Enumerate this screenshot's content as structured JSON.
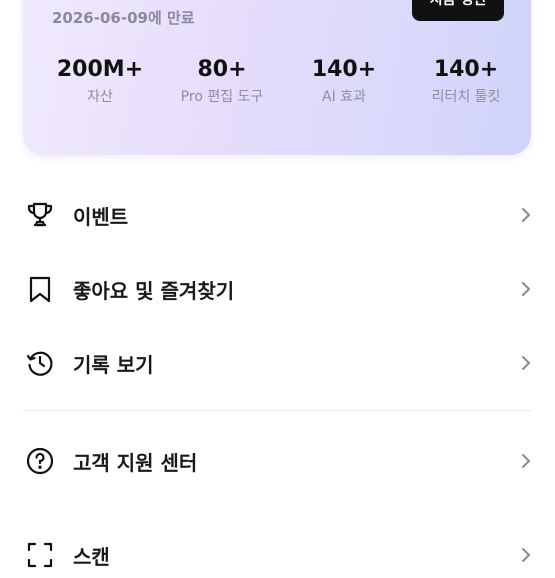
{
  "subscription": {
    "expiry": "2026-06-09에 만료",
    "renew_label": "지금 갱신"
  },
  "stats": [
    {
      "value": "200M+",
      "label": "자산"
    },
    {
      "value": "80+",
      "label": "Pro 편집 도구"
    },
    {
      "value": "140+",
      "label": "AI 효과"
    },
    {
      "value": "140+",
      "label": "리터치 툴킷"
    }
  ],
  "menu": {
    "items": [
      {
        "label": "이벤트",
        "icon": "trophy-icon"
      },
      {
        "label": "좋아요 및 즐겨찾기",
        "icon": "bookmark-icon"
      },
      {
        "label": "기록 보기",
        "icon": "history-icon"
      },
      {
        "label": "고객 지원 센터",
        "icon": "help-circle-icon"
      },
      {
        "label": "스캔",
        "icon": "scan-icon"
      }
    ]
  },
  "colors": {
    "card_gradient_start": "#f0eafd",
    "card_gradient_end": "#cfd3fa",
    "button_bg": "#111111",
    "muted_text": "#8e8e9c",
    "chevron": "#8a8a8a"
  }
}
